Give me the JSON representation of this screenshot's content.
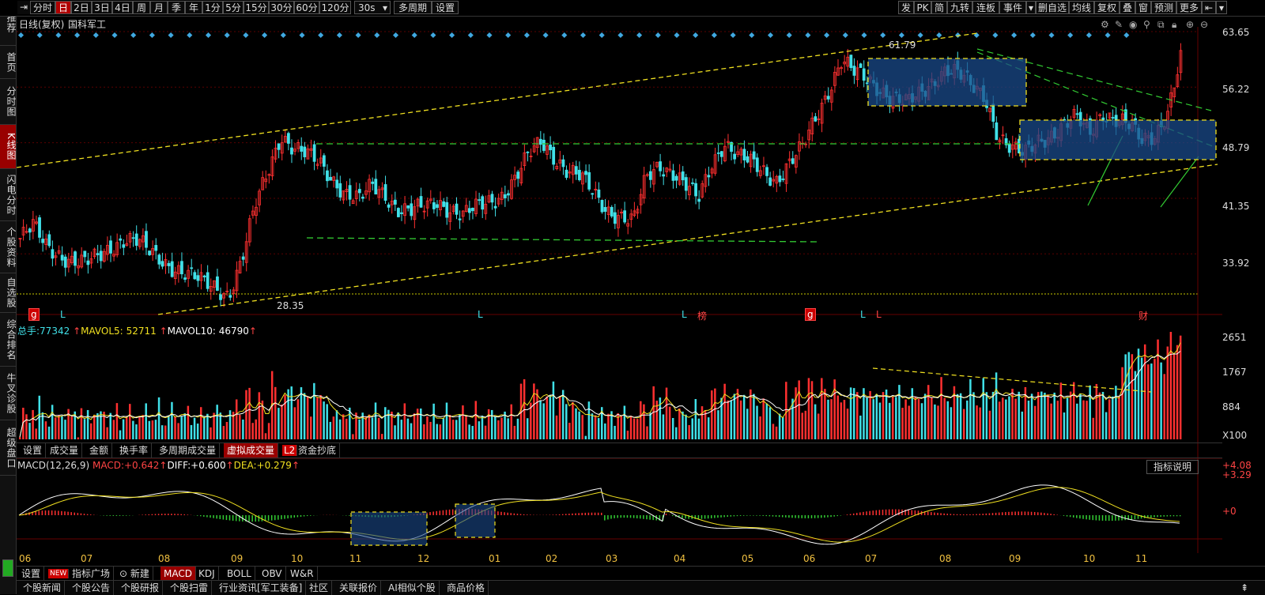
{
  "toolbar": {
    "left_items": [
      "分时",
      "日",
      "2日",
      "3日",
      "4日",
      "周",
      "月",
      "季",
      "年",
      "1分",
      "5分",
      "15分",
      "30分",
      "60分",
      "120分",
      "30s",
      "多周期",
      "设置"
    ],
    "right_items": [
      "发",
      "PK",
      "简",
      "九转",
      "连板",
      "事件",
      "删自选",
      "均线",
      "复权",
      "叠",
      "窗",
      "预测",
      "更多"
    ],
    "active": "日"
  },
  "sidebar": {
    "items": [
      "推荐",
      "首页",
      "分时图",
      "K线图",
      "闪电分时",
      "个股资料",
      "自选股",
      "综合排名",
      "牛叉诊股",
      "超级盘口"
    ],
    "active": "K线图"
  },
  "chart_header": {
    "title": "日线(复权)",
    "stock": "国科军工"
  },
  "price_axis": [
    "63.65",
    "56.22",
    "48.79",
    "41.35",
    "33.92"
  ],
  "price_annotations": {
    "high": "61.79",
    "low": "28.35"
  },
  "event_markers": [
    "g",
    "L",
    "L",
    "L",
    "榜",
    "g",
    "L",
    "L",
    "财"
  ],
  "volume_header": {
    "total_label": "总手:",
    "total": "77342",
    "mavol5_label": "MAVOL5:",
    "mavol5": "52711",
    "mavol10_label": "MAVOL10:",
    "mavol10": "46790"
  },
  "volume_axis": [
    "2651",
    "1767",
    "884",
    "X100"
  ],
  "volume_tabs": [
    "设置",
    "成交量",
    "金额",
    "换手率",
    "多周期成交量",
    "虚拟成交量",
    "L2",
    "资金抄底"
  ],
  "volume_active": "虚拟成交量",
  "macd_header": {
    "name": "MACD(12,26,9)",
    "macd_label": "MACD:",
    "macd": "+0.642",
    "diff_label": "DIFF:",
    "diff": "+0.600",
    "dea_label": "DEA:",
    "dea": "+0.279"
  },
  "macd_axis": [
    "+4.08",
    "+3.29",
    "+0"
  ],
  "macd_button": "指标说明",
  "months": [
    "06",
    "07",
    "08",
    "09",
    "10",
    "11",
    "12",
    "01",
    "02",
    "03",
    "04",
    "05",
    "06",
    "07",
    "08",
    "09",
    "10",
    "11"
  ],
  "indicator_tabs": [
    "设置",
    "NEW",
    "指标广场",
    "新建",
    "MACD",
    "KDJ",
    "BOLL",
    "OBV",
    "W&R"
  ],
  "indicator_active": "MACD",
  "bottom_tabs": [
    "个股新闻",
    "个股公告",
    "个股研报",
    "个股扫雷",
    "行业资讯[军工装备]",
    "社区",
    "关联报价",
    "AI相似个股",
    "商品价格"
  ],
  "colors": {
    "up": "#ff3030",
    "down": "#40e0e8",
    "accent": "#b00000",
    "ma_yellow": "#f0e020",
    "ma_white": "#ffffff"
  },
  "chart_data": {
    "type": "candlestick",
    "price_range": [
      28.35,
      63.65
    ],
    "close_series": [
      36,
      37.5,
      35,
      34,
      33,
      32.5,
      33.5,
      35,
      36,
      35.5,
      34,
      33,
      32,
      31,
      30,
      29.5,
      28.6,
      33,
      40,
      45,
      50,
      48,
      47,
      46,
      44,
      42,
      41,
      43,
      42,
      40,
      39.5,
      40,
      41,
      40,
      39,
      40,
      41,
      42,
      44,
      47,
      49,
      47,
      45,
      44,
      42,
      40,
      39,
      38,
      44,
      46,
      45,
      43,
      41,
      46,
      49,
      47,
      46,
      45,
      44,
      46,
      48,
      52,
      56,
      60,
      58,
      57,
      56,
      55,
      54,
      55,
      57,
      59,
      58,
      56,
      55,
      50,
      48,
      47,
      49,
      50,
      51,
      52,
      50,
      53,
      52,
      51,
      49,
      50,
      53,
      60
    ]
  }
}
